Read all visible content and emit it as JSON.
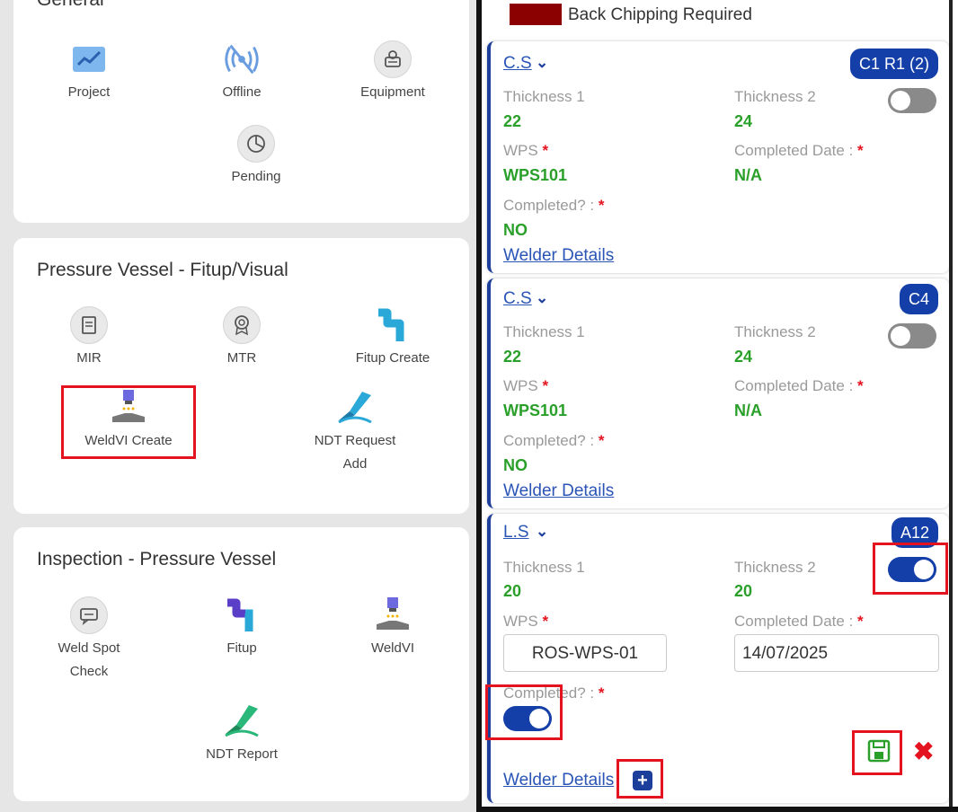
{
  "left": {
    "general": {
      "title": "General",
      "tiles": [
        {
          "label": "Project",
          "icon": "chart-icon"
        },
        {
          "label": "Offline",
          "icon": "offline-icon"
        },
        {
          "label": "Equipment",
          "icon": "equipment-icon"
        },
        {
          "label": "Pending",
          "icon": "pie-chart-icon"
        }
      ]
    },
    "pv_fitup": {
      "title": "Pressure Vessel - Fitup/Visual",
      "tiles": [
        {
          "label": "MIR",
          "icon": "document-icon"
        },
        {
          "label": "MTR",
          "icon": "badge-icon"
        },
        {
          "label": "Fitup Create",
          "icon": "pipe-icon"
        },
        {
          "label": "WeldVI Create",
          "icon": "weld-icon"
        },
        {
          "label": "NDT Request",
          "label2": "Add",
          "icon": "ndt-icon"
        }
      ]
    },
    "inspection": {
      "title": "Inspection - Pressure Vessel",
      "tiles": [
        {
          "label": "Weld Spot",
          "label2": "Check",
          "icon": "message-icon"
        },
        {
          "label": "Fitup",
          "icon": "pipe-icon"
        },
        {
          "label": "WeldVI",
          "icon": "weld-icon"
        },
        {
          "label": "NDT Report",
          "icon": "ndt-icon"
        }
      ]
    }
  },
  "right": {
    "legend": {
      "label": "Back Chipping Required",
      "color": "#8b0000"
    },
    "entries": [
      {
        "type": "C.S",
        "badge": "C1 R1 (2)",
        "thickness1_label": "Thickness 1",
        "thickness1": "22",
        "thickness2_label": "Thickness 2",
        "thickness2": "24",
        "wps_label": "WPS",
        "wps": "WPS101",
        "date_label": "Completed Date :",
        "date": "N/A",
        "completed_label": "Completed? :",
        "completed": "NO",
        "welder_link": "Welder Details"
      },
      {
        "type": "C.S",
        "badge": "C4",
        "thickness1_label": "Thickness 1",
        "thickness1": "22",
        "thickness2_label": "Thickness 2",
        "thickness2": "24",
        "wps_label": "WPS",
        "wps": "WPS101",
        "date_label": "Completed Date :",
        "date": "N/A",
        "completed_label": "Completed? :",
        "completed": "NO",
        "welder_link": "Welder Details"
      },
      {
        "type": "L.S",
        "badge": "A12",
        "thickness1_label": "Thickness 1",
        "thickness1": "20",
        "thickness2_label": "Thickness 2",
        "thickness2": "20",
        "wps_label": "WPS",
        "wps_value": "ROS-WPS-01",
        "date_label": "Completed Date :",
        "date_value": "14/07/2025",
        "completed_label": "Completed? :",
        "welder_link": "Welder Details"
      }
    ],
    "colors": {
      "accent": "#143fa8",
      "value_green": "#2aa02a",
      "required_red": "#e3141f"
    }
  }
}
